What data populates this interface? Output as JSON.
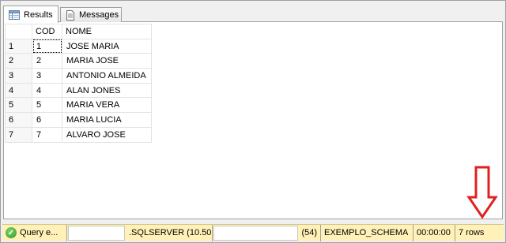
{
  "tabs": [
    {
      "label": "Results",
      "icon": "grid-icon",
      "active": true
    },
    {
      "label": "Messages",
      "icon": "document-icon",
      "active": false
    }
  ],
  "grid": {
    "columns": [
      "COD",
      "NOME"
    ],
    "rows": [
      {
        "num": "1",
        "cod": "1",
        "nome": "JOSE MARIA"
      },
      {
        "num": "2",
        "cod": "2",
        "nome": "MARIA JOSE"
      },
      {
        "num": "3",
        "cod": "3",
        "nome": "ANTONIO ALMEIDA"
      },
      {
        "num": "4",
        "cod": "4",
        "nome": "ALAN JONES"
      },
      {
        "num": "5",
        "cod": "5",
        "nome": "MARIA VERA"
      },
      {
        "num": "6",
        "cod": "6",
        "nome": "MARIA LUCIA"
      },
      {
        "num": "7",
        "cod": "7",
        "nome": "ALVARO JOSE"
      }
    ]
  },
  "statusbar": {
    "status": "Query e...",
    "server": ".SQLSERVER (10.50...",
    "spid": "(54)",
    "database": "EXEMPLO_SCHEMA",
    "elapsed": "00:00:00",
    "rows": "7 rows"
  },
  "colors": {
    "statusbar_bg": "#fff1b7",
    "arrow": "#e0201f",
    "ok": "#2e9a22"
  }
}
